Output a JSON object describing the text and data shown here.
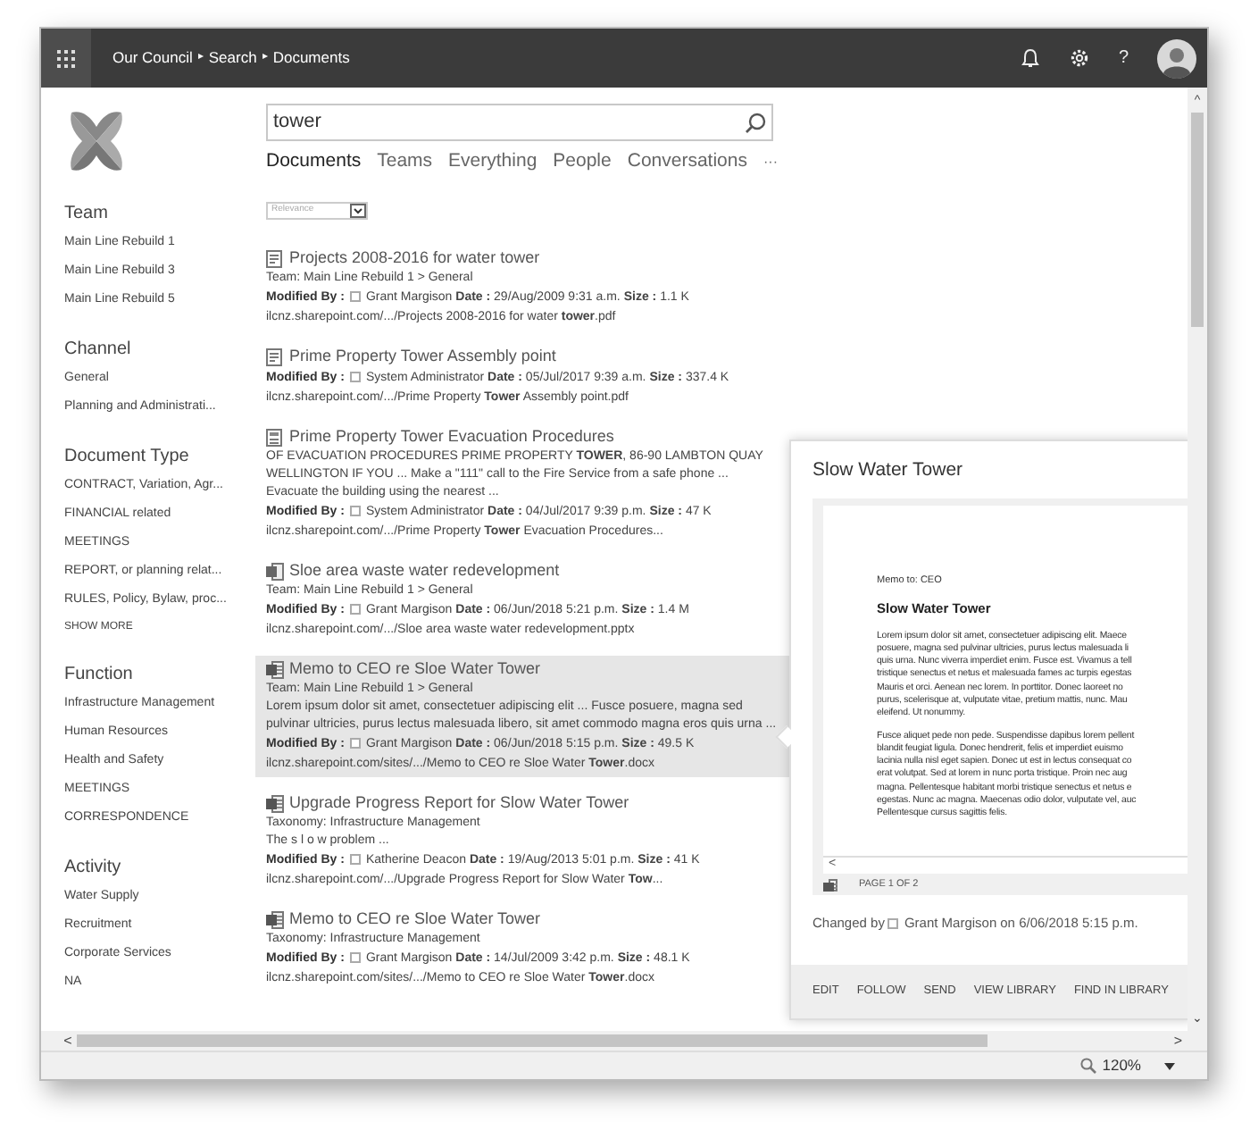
{
  "top_bar": {
    "breadcrumb": [
      {
        "label": "Our Council",
        "separator": "▸"
      },
      {
        "label": "Search",
        "separator": "▸"
      },
      {
        "label": "Documents"
      }
    ],
    "help": "?"
  },
  "search": {
    "value": "tower"
  },
  "tabs": [
    {
      "label": "Documents",
      "selected": true
    },
    {
      "label": "Teams",
      "selected": false
    },
    {
      "label": "Everything",
      "selected": false
    },
    {
      "label": "People",
      "selected": false
    },
    {
      "label": "Conversations",
      "selected": false
    }
  ],
  "more": "···",
  "sort": {
    "value": "Relevance"
  },
  "refiners": [
    {
      "heading": "Team",
      "items": [
        "Main Line Rebuild 1",
        "Main Line Rebuild 3",
        "Main Line Rebuild 5"
      ]
    },
    {
      "heading": "Channel",
      "items": [
        "General",
        "Planning and Administrati..."
      ]
    },
    {
      "heading": "Document Type",
      "items": [
        "CONTRACT, Variation, Agr...",
        "FINANCIAL related",
        "MEETINGS",
        "REPORT, or planning relat...",
        "RULES, Policy, Bylaw, proc..."
      ],
      "show_more": "SHOW MORE"
    },
    {
      "heading": "Function",
      "items": [
        "Infrastructure Management",
        "Human Resources",
        "Health and Safety",
        "MEETINGS",
        "CORRESPONDENCE"
      ]
    },
    {
      "heading": "Activity",
      "items": [
        "Water Supply",
        "Recruitment",
        "Corporate Services",
        "NA"
      ]
    }
  ],
  "results": [
    {
      "kind": "pdf",
      "title": "Projects 2008-2016 for water tower",
      "location": "Team: Main Line Rebuild 1 > General",
      "modified_label": "Modified By :",
      "modified": "Grant Margison **Date :** 29/Aug/2009 9:31 a.m. **Size :** 1.1 K",
      "url": "ilcnz.sharepoint.com/.../Projects 2008-2016 for water **tower**.pdf",
      "selected": false
    },
    {
      "kind": "pdf",
      "title": "Prime Property Tower Assembly point",
      "modified_label": "Modified By :",
      "modified": "System Administrator **Date :** 05/Jul/2017 9:39 a.m. **Size :** 337.4 K",
      "url": "ilcnz.sharepoint.com/.../Prime Property **Tower** Assembly point.pdf",
      "selected": false
    },
    {
      "kind": "doc",
      "title": "Prime Property Tower Evacuation Procedures",
      "summary": "OF EVACUATION PROCEDURES PRIME PROPERTY **TOWER**, 86-90 LAMBTON QUAY WELLINGTON IF YOU ... Make a \"111\" call to the Fire Service from a safe phone ... Evacuate the building using the nearest ...",
      "modified_label": "Modified By :",
      "modified": "System Administrator **Date :** 04/Jul/2017 9:39 p.m. **Size :** 47 K",
      "url": "ilcnz.sharepoint.com/.../Prime Property **Tower** Evacuation Procedures...",
      "selected": false
    },
    {
      "kind": "pptx",
      "title": "Sloe area waste water redevelopment",
      "location": "Team: Main Line Rebuild 1 > General",
      "modified_label": "Modified By :",
      "modified": "Grant Margison **Date :** 06/Jun/2018 5:21 p.m. **Size :** 1.4 M",
      "url": "ilcnz.sharepoint.com/.../Sloe area waste water redevelopment.pptx",
      "selected": false
    },
    {
      "kind": "docx",
      "title": "Memo to CEO re Sloe Water Tower",
      "location": "Team: Main Line Rebuild 1 > General",
      "summary": "Lorem ipsum dolor sit amet, consectetuer adipiscing elit ... Fusce posuere, magna sed pulvinar ultricies, purus lectus malesuada libero, sit amet commodo magna eros quis urna ...",
      "modified_label": "Modified By :",
      "modified": "Grant Margison **Date :** 06/Jun/2018 5:15 p.m. **Size :** 49.5 K",
      "url": "ilcnz.sharepoint.com/sites/.../Memo to CEO re Sloe Water **Tower**.docx",
      "selected": true
    },
    {
      "kind": "docx",
      "title": "Upgrade Progress Report for Slow Water Tower",
      "location": "Taxonomy: Infrastructure Management",
      "summary": "The s l o w problem ...",
      "modified_label": "Modified By :",
      "modified": "Katherine Deacon **Date :** 19/Aug/2013 5:01 p.m. **Size :** 41 K",
      "url": "ilcnz.sharepoint.com/.../Upgrade Progress Report for Slow Water **Tow**...",
      "selected": false
    },
    {
      "kind": "docx",
      "title": "Memo to CEO re Sloe Water Tower",
      "location": "Taxonomy: Infrastructure Management",
      "modified_label": "Modified By :",
      "modified": "Grant Margison **Date :** 14/Jul/2009 3:42 p.m. **Size :** 48.1 K",
      "url": "ilcnz.sharepoint.com/sites/.../Memo to CEO re Sloe Water **Tower**.docx",
      "selected": false
    }
  ],
  "preview": {
    "title": "Slow Water Tower",
    "document": {
      "memo_line": "Memo to: CEO",
      "heading": "Slow Water Tower",
      "paragraphs": [
        [
          "Lorem ipsum dolor sit amet, consectetuer adipiscing elit. Maece",
          "posuere, magna sed pulvinar ultricies, purus lectus malesuada li",
          "quis urna. Nunc viverra imperdiet enim. Fusce est. Vivamus a tell",
          "tristique senectus et netus et malesuada fames ac turpis egestas",
          "Mauris et orci. Aenean nec lorem. In porttitor. Donec laoreet no",
          "purus, scelerisque at, vulputate vitae, pretium mattis, nunc. Mau",
          "eleifend. Ut nonummy."
        ],
        [
          "Fusce aliquet pede non pede. Suspendisse dapibus lorem pellent",
          "blandit feugiat ligula. Donec hendrerit, felis et imperdiet euismo",
          "lacinia nulla nisl eget sapien. Donec ut est in lectus consequat co",
          "erat volutpat. Sed at lorem in nunc porta tristique. Proin nec aug",
          "magna. Pellentesque habitant morbi tristique senectus et netus e",
          "egestas. Nunc ac magna. Maecenas odio dolor, vulputate vel, auc",
          "Pellentesque cursus sagittis felis."
        ]
      ],
      "scroll_left": "<",
      "page": "PAGE 1 OF 2"
    },
    "changed_label": "Changed by",
    "changed_by": "Grant Margison",
    "changed_on": "on 6/06/2018 5:15 p.m.",
    "actions": [
      "EDIT",
      "FOLLOW",
      "SEND",
      "VIEW LIBRARY",
      "FIND IN LIBRARY"
    ]
  },
  "scrollbars": {
    "up": "^",
    "left": "<",
    "right": ">",
    "down": "⌄"
  },
  "status_bar": {
    "zoom": "120%"
  }
}
